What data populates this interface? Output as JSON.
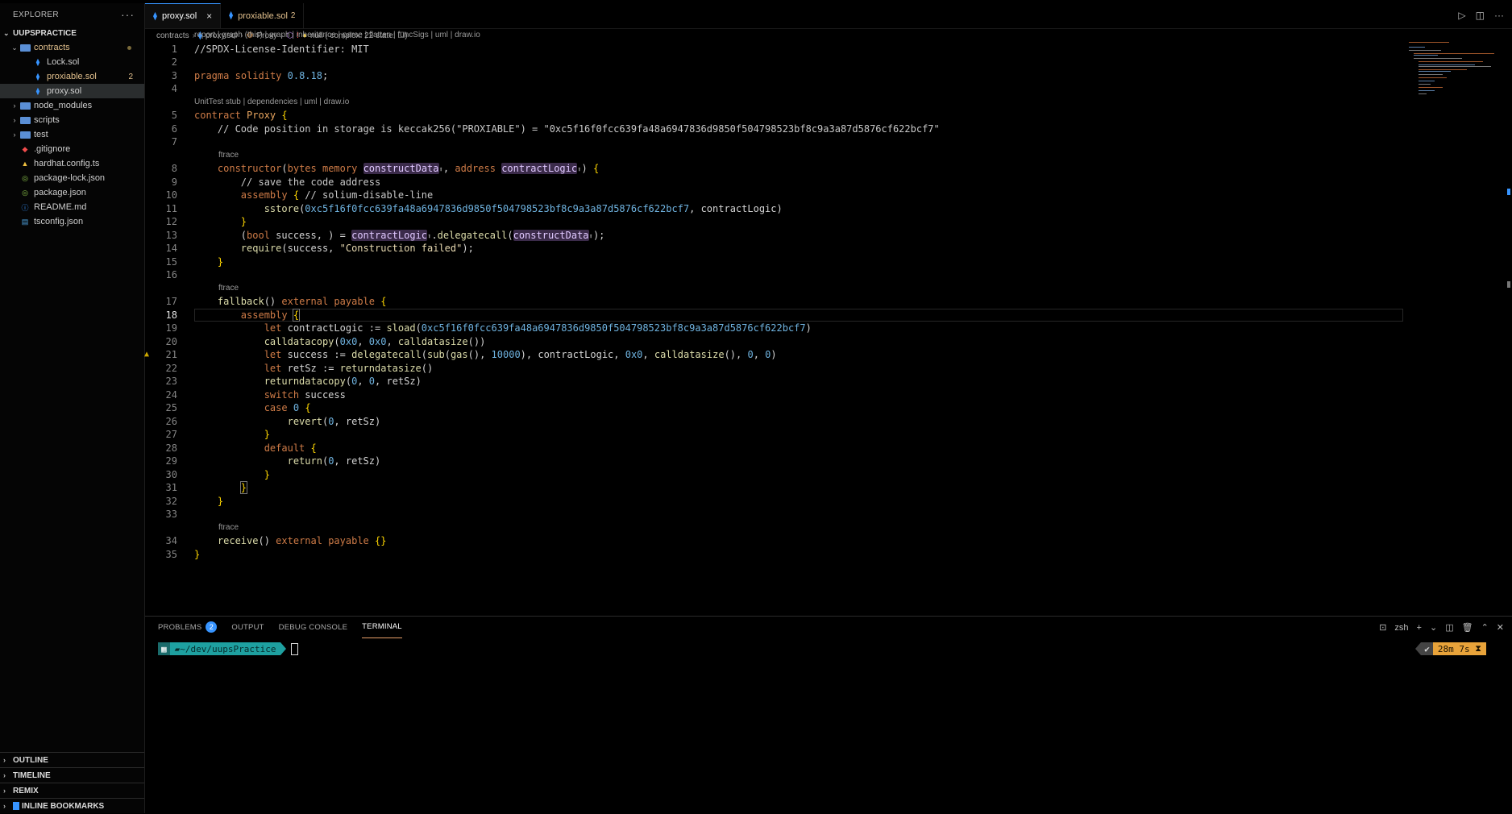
{
  "sidebar": {
    "title": "EXPLORER",
    "menu_icon": "ellipsis-icon",
    "project": "UUPSPRACTICE",
    "items": [
      {
        "label": "contracts",
        "type": "folder",
        "open": true,
        "depth": 1,
        "modified": true
      },
      {
        "label": "Lock.sol",
        "type": "sol",
        "depth": 2
      },
      {
        "label": "proxiable.sol",
        "type": "sol",
        "depth": 2,
        "badge": "2",
        "warning": true
      },
      {
        "label": "proxy.sol",
        "type": "sol",
        "depth": 2,
        "selected": true
      },
      {
        "label": "node_modules",
        "type": "folder",
        "depth": 1
      },
      {
        "label": "scripts",
        "type": "folder",
        "depth": 1
      },
      {
        "label": "test",
        "type": "folder",
        "depth": 1
      },
      {
        "label": ".gitignore",
        "type": "git",
        "depth": 1
      },
      {
        "label": "hardhat.config.ts",
        "type": "hardhat",
        "depth": 1
      },
      {
        "label": "package-lock.json",
        "type": "json",
        "depth": 1
      },
      {
        "label": "package.json",
        "type": "json",
        "depth": 1
      },
      {
        "label": "README.md",
        "type": "info",
        "depth": 1
      },
      {
        "label": "tsconfig.json",
        "type": "ts",
        "depth": 1
      }
    ],
    "sections": [
      "OUTLINE",
      "TIMELINE",
      "REMIX",
      "INLINE BOOKMARKS"
    ]
  },
  "tabs": [
    {
      "label": "proxy.sol",
      "active": true,
      "close": "×"
    },
    {
      "label": "proxiable.sol",
      "badge": "2",
      "active": false
    }
  ],
  "breadcrumb": {
    "folder": "contracts",
    "file": "proxy.sol",
    "symbol": "Proxy",
    "extra": "null (  complex: 22 state: ☐)"
  },
  "top_lens": "report | graph (this) | graph | inheritance | parse | flatten | funcSigs | uml | draw.io",
  "code_lens": {
    "contract": "UnitTest stub | dependencies | uml | draw.io",
    "ftrace": "ftrace"
  },
  "current_line": 18,
  "panel": {
    "tabs": [
      {
        "label": "PROBLEMS",
        "badge": "2"
      },
      {
        "label": "OUTPUT"
      },
      {
        "label": "DEBUG CONSOLE"
      },
      {
        "label": "TERMINAL",
        "active": true
      }
    ],
    "shell": "zsh",
    "prompt_path": "~/dev/uupsPractice",
    "elapsed": "28m 7s",
    "check": "✔"
  },
  "colors": {
    "accent": "#3794ff",
    "keyword": "#ce7b47",
    "number": "#6fb3e0",
    "warning": "#e2c08d"
  }
}
